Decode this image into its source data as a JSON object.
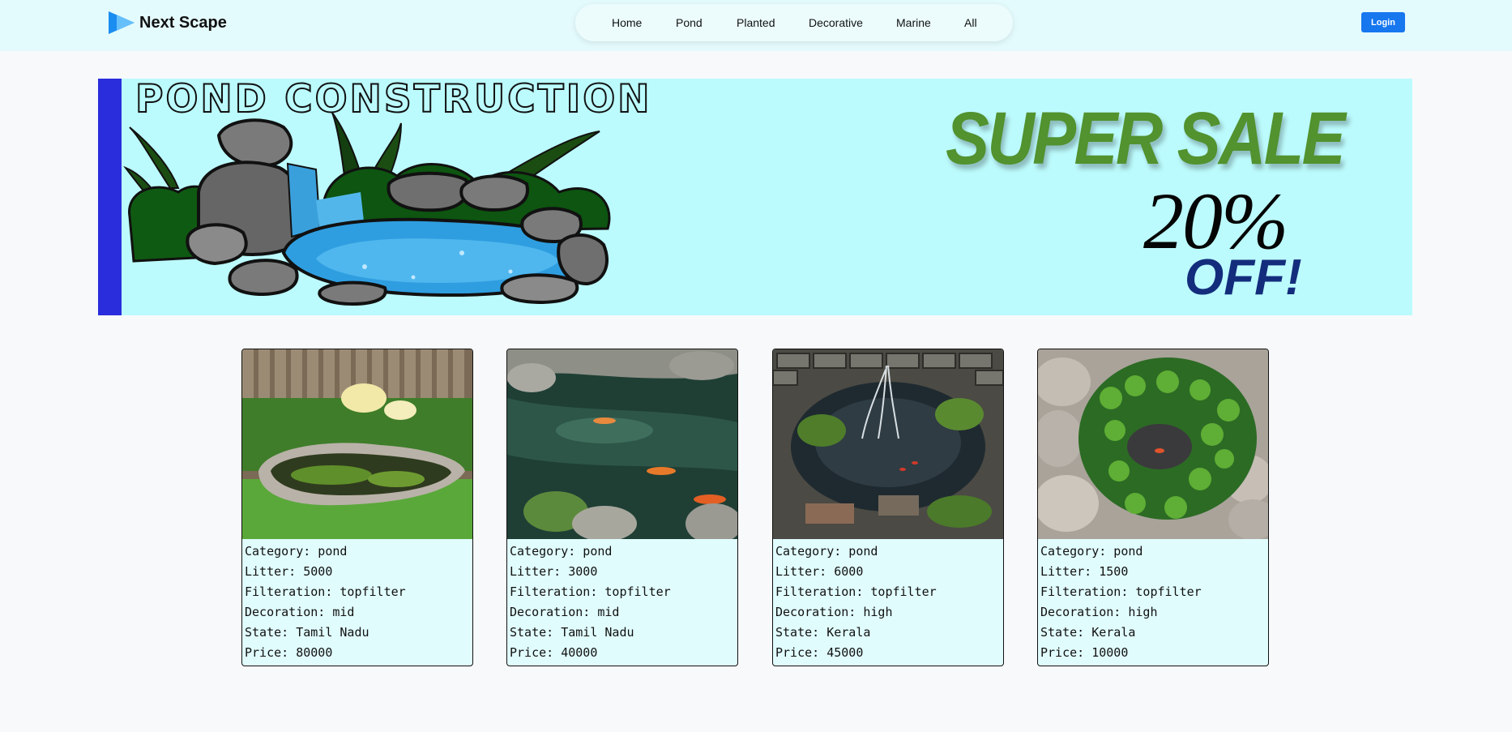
{
  "brand": {
    "name": "Next Scape",
    "logo_icon": "play-triangle-icon"
  },
  "nav": {
    "items": [
      "Home",
      "Pond",
      "Planted",
      "Decorative",
      "Marine",
      "All"
    ]
  },
  "header": {
    "login_label": "Login",
    "login_color": "#1677ef"
  },
  "banner": {
    "title": "POND CONSTRUCTION",
    "sale_text": "SUPER SALE",
    "discount": "20%",
    "off_text": "OFF!",
    "background_color": "#bcfbfd",
    "stripe_color": "#2a2ddb"
  },
  "products": [
    {
      "image": "garden-pond-photo",
      "lines": [
        "Category: pond",
        "Litter: 5000",
        "Filteration: topfilter",
        "Decoration: mid",
        "State: Tamil Nadu",
        "Price: 80000"
      ]
    },
    {
      "image": "koi-pond-photo",
      "lines": [
        "Category: pond",
        "Litter: 3000",
        "Filteration: topfilter",
        "Decoration: mid",
        "State: Tamil Nadu",
        "Price: 40000"
      ]
    },
    {
      "image": "fountain-pond-photo",
      "lines": [
        "Category: pond",
        "Litter: 6000",
        "Filteration: topfilter",
        "Decoration: high",
        "State: Kerala",
        "Price: 45000"
      ]
    },
    {
      "image": "plant-pond-photo",
      "lines": [
        "Category: pond",
        "Litter: 1500",
        "Filteration: topfilter",
        "Decoration: high",
        "State: Kerala",
        "Price: 10000"
      ]
    }
  ]
}
